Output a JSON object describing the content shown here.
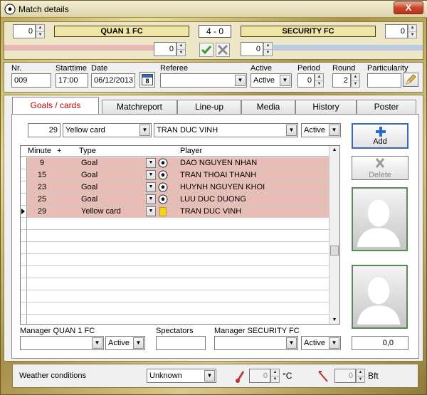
{
  "window": {
    "title": "Match details",
    "close_label": "X"
  },
  "score": {
    "home_team": "QUAN 1 FC",
    "away_team": "SECURITY FC",
    "result": "4 - 0",
    "home_left_value": "0",
    "away_right_value": "0",
    "home_extra_value": "0",
    "away_extra_value": "0"
  },
  "match": {
    "nr_label": "Nr.",
    "nr_value": "009",
    "starttime_label": "Starttime",
    "starttime_value": "17:00",
    "date_label": "Date",
    "date_value": "06/12/2013",
    "calendar_day": "8",
    "referee_label": "Referee",
    "referee_value": "",
    "active_label": "Active",
    "active_value": "Active",
    "period_label": "Period",
    "period_value": "0",
    "round_label": "Round",
    "round_value": "2",
    "particularity_label": "Particularity",
    "particularity_value": ""
  },
  "tabs": [
    {
      "label": "Goals / cards"
    },
    {
      "label": "Matchreport"
    },
    {
      "label": "Line-up"
    },
    {
      "label": "Media"
    },
    {
      "label": "History"
    },
    {
      "label": "Poster"
    }
  ],
  "entry": {
    "minute": "29",
    "type": "Yellow card",
    "player": "TRAN DUC VINH",
    "status": "Active"
  },
  "buttons": {
    "add": "Add",
    "delete": "Delete"
  },
  "grid": {
    "headers": {
      "minute": "Minute",
      "plus": "+",
      "type": "Type",
      "player": "Player"
    },
    "rows": [
      {
        "minute": "9",
        "type": "Goal",
        "player": "DAO NGUYEN NHAN",
        "kind": "goal"
      },
      {
        "minute": "15",
        "type": "Goal",
        "player": "TRAN THOAI THANH",
        "kind": "goal"
      },
      {
        "minute": "23",
        "type": "Goal",
        "player": "HUYNH NGUYEN KHOI",
        "kind": "goal"
      },
      {
        "minute": "25",
        "type": "Goal",
        "player": "LUU DUC DUONG",
        "kind": "goal"
      },
      {
        "minute": "29",
        "type": "Yellow card",
        "player": "TRAN DUC VINH",
        "kind": "yellow"
      }
    ]
  },
  "footer": {
    "manager_home_label": "Manager QUAN 1 FC",
    "manager_home_value": "",
    "manager_home_status": "Active",
    "spectators_label": "Spectators",
    "spectators_value": "",
    "manager_away_label": "Manager SECURITY FC",
    "manager_away_value": "",
    "manager_away_status": "Active",
    "rating_value": "0,0"
  },
  "weather": {
    "label": "Weather conditions",
    "condition": "Unknown",
    "temperature": "0",
    "temp_unit": "°C",
    "wind": "0",
    "wind_unit": "Bft"
  },
  "colors": {
    "accent_tab": "#c00000",
    "row_highlight": "#e8bdb6",
    "team_box": "#efe6a6"
  }
}
